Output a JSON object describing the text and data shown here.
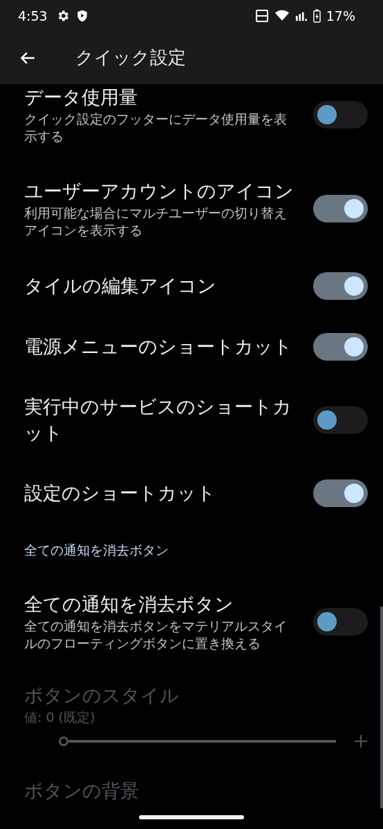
{
  "status_bar": {
    "time": "4:53",
    "battery": "17%"
  },
  "header": {
    "title": "クイック設定"
  },
  "items": [
    {
      "kind": "switch",
      "title": "データ使用量",
      "summary": "クイック設定のフッターにデータ使用量を表示する",
      "on": false
    },
    {
      "kind": "switch",
      "title": "ユーザーアカウントのアイコン",
      "summary": "利用可能な場合にマルチユーザーの切り替えアイコンを表示する",
      "on": true
    },
    {
      "kind": "switch",
      "title": "タイルの編集アイコン",
      "on": true
    },
    {
      "kind": "switch",
      "title": "電源メニューのショートカット",
      "on": true
    },
    {
      "kind": "switch",
      "title": "実行中のサービスのショートカット",
      "on": false
    },
    {
      "kind": "switch",
      "title": "設定のショートカット",
      "on": true
    },
    {
      "kind": "category",
      "title": "全ての通知を消去ボタン"
    },
    {
      "kind": "switch",
      "title": "全ての通知を消去ボタン",
      "summary": "全ての通知を消去ボタンをマテリアルスタイルのフローティングボタンに置き換える",
      "on": false
    },
    {
      "kind": "slider",
      "title": "ボタンのスタイル",
      "summary": "値: 0 (既定)",
      "disabled": true,
      "level": 0
    },
    {
      "kind": "plain",
      "title": "ボタンの背景",
      "disabled": true
    }
  ]
}
